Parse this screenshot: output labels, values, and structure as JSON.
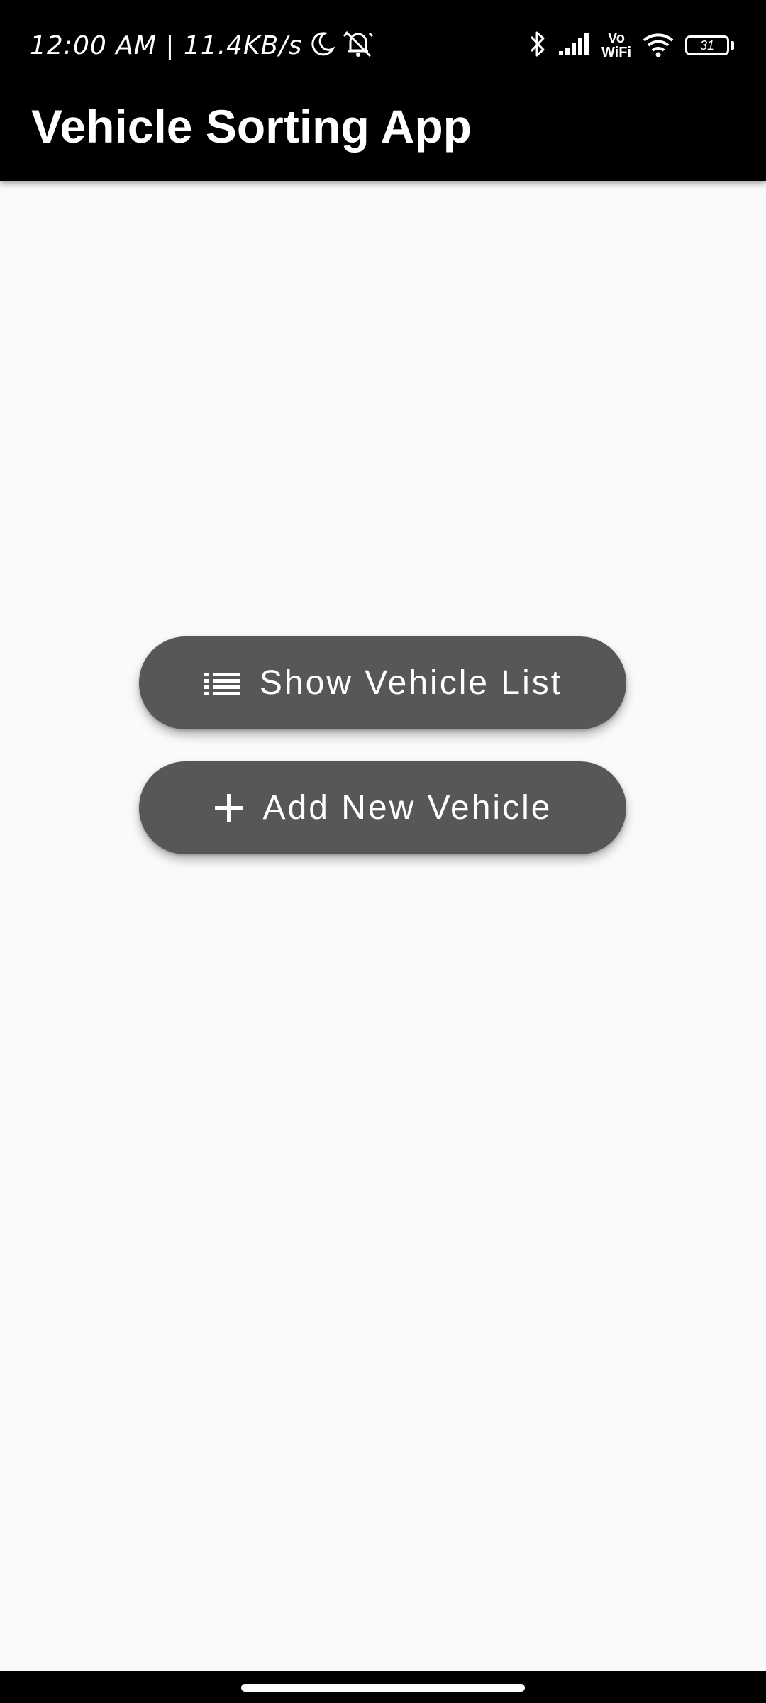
{
  "status_bar": {
    "time_text": "12:00 AM | 11.4KB/s",
    "vowifi_top": "Vo",
    "vowifi_bottom": "WiFi",
    "battery_level": "31",
    "icons": [
      "moon-icon",
      "alarm-off-icon",
      "bluetooth-icon",
      "signal-icon",
      "wifi-icon",
      "battery-icon"
    ]
  },
  "app_bar": {
    "title": "Vehicle Sorting App"
  },
  "actions": {
    "show_list": {
      "label": "Show Vehicle List",
      "icon": "list-icon"
    },
    "add_vehicle": {
      "label": "Add New Vehicle",
      "icon": "plus-icon"
    }
  },
  "colors": {
    "app_bar_bg": "#000000",
    "background": "#fafafa",
    "button_bg": "#575757",
    "button_text": "#ffffff"
  }
}
